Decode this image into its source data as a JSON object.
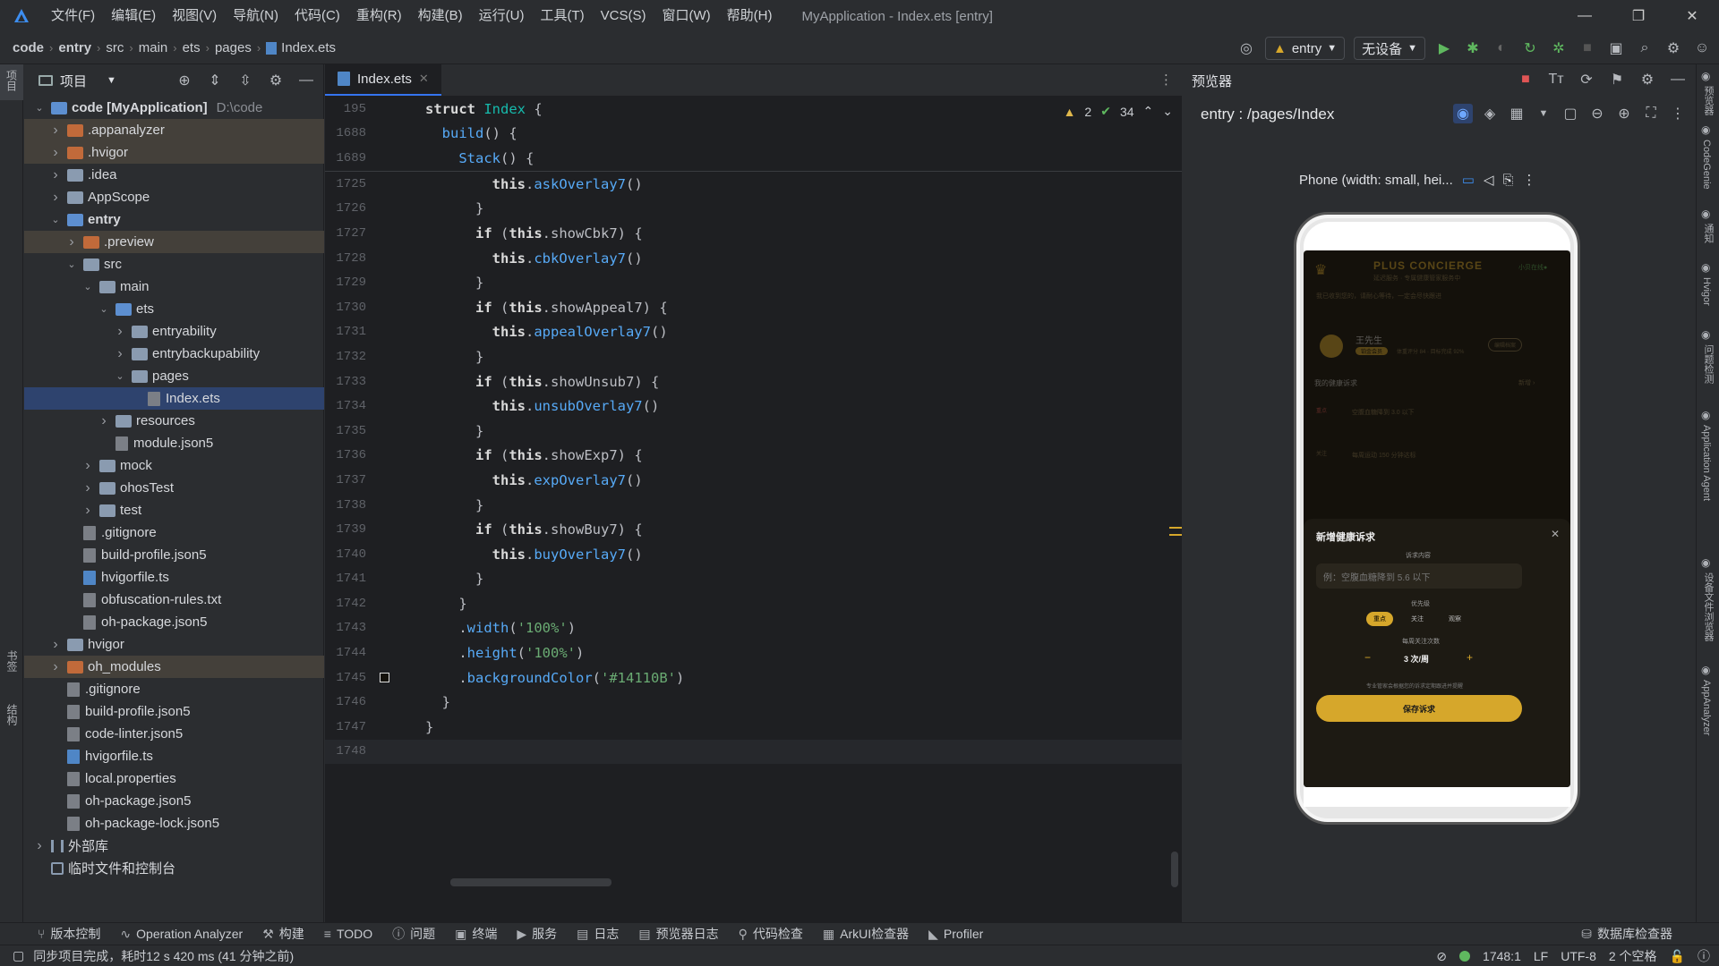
{
  "titlebar": {
    "menus": [
      "文件(F)",
      "编辑(E)",
      "视图(V)",
      "导航(N)",
      "代码(C)",
      "重构(R)",
      "构建(B)",
      "运行(U)",
      "工具(T)",
      "VCS(S)",
      "窗口(W)",
      "帮助(H)"
    ],
    "window_title": "MyApplication - Index.ets [entry]"
  },
  "navbar": {
    "breadcrumb": [
      "code",
      "entry",
      "src",
      "main",
      "ets",
      "pages",
      "Index.ets"
    ],
    "run_config": "entry",
    "device": "无设备"
  },
  "project": {
    "title": "项目",
    "tree": [
      {
        "label": "code [MyApplication]",
        "extra": "D:\\code",
        "level": 0,
        "arrow": "open",
        "icon": "folder-blue",
        "bold": true
      },
      {
        "label": ".appanalyzer",
        "level": 1,
        "arrow": "closed",
        "icon": "folder-orange",
        "hl": true
      },
      {
        "label": ".hvigor",
        "level": 1,
        "arrow": "closed",
        "icon": "folder-orange",
        "hl": true
      },
      {
        "label": ".idea",
        "level": 1,
        "arrow": "closed",
        "icon": "folder"
      },
      {
        "label": "AppScope",
        "level": 1,
        "arrow": "closed",
        "icon": "folder"
      },
      {
        "label": "entry",
        "level": 1,
        "arrow": "open",
        "icon": "folder-blue",
        "bold": true
      },
      {
        "label": ".preview",
        "level": 2,
        "arrow": "closed",
        "icon": "folder-orange",
        "hl": true
      },
      {
        "label": "src",
        "level": 2,
        "arrow": "open",
        "icon": "folder"
      },
      {
        "label": "main",
        "level": 3,
        "arrow": "open",
        "icon": "folder"
      },
      {
        "label": "ets",
        "level": 4,
        "arrow": "open",
        "icon": "folder-blue"
      },
      {
        "label": "entryability",
        "level": 5,
        "arrow": "closed",
        "icon": "folder"
      },
      {
        "label": "entrybackupability",
        "level": 5,
        "arrow": "closed",
        "icon": "folder"
      },
      {
        "label": "pages",
        "level": 5,
        "arrow": "open",
        "icon": "folder"
      },
      {
        "label": "Index.ets",
        "level": 6,
        "arrow": "none",
        "icon": "file",
        "sel": true
      },
      {
        "label": "resources",
        "level": 4,
        "arrow": "closed",
        "icon": "folder"
      },
      {
        "label": "module.json5",
        "level": 4,
        "arrow": "none",
        "icon": "file"
      },
      {
        "label": "mock",
        "level": 3,
        "arrow": "closed",
        "icon": "folder"
      },
      {
        "label": "ohosTest",
        "level": 3,
        "arrow": "closed",
        "icon": "folder"
      },
      {
        "label": "test",
        "level": 3,
        "arrow": "closed",
        "icon": "folder"
      },
      {
        "label": ".gitignore",
        "level": 2,
        "arrow": "none",
        "icon": "file"
      },
      {
        "label": "build-profile.json5",
        "level": 2,
        "arrow": "none",
        "icon": "file"
      },
      {
        "label": "hvigorfile.ts",
        "level": 2,
        "arrow": "none",
        "icon": "file-ts"
      },
      {
        "label": "obfuscation-rules.txt",
        "level": 2,
        "arrow": "none",
        "icon": "file"
      },
      {
        "label": "oh-package.json5",
        "level": 2,
        "arrow": "none",
        "icon": "file"
      },
      {
        "label": "hvigor",
        "level": 1,
        "arrow": "closed",
        "icon": "folder"
      },
      {
        "label": "oh_modules",
        "level": 1,
        "arrow": "closed",
        "icon": "folder-orange",
        "hl": true
      },
      {
        "label": ".gitignore",
        "level": 1,
        "arrow": "none",
        "icon": "file"
      },
      {
        "label": "build-profile.json5",
        "level": 1,
        "arrow": "none",
        "icon": "file"
      },
      {
        "label": "code-linter.json5",
        "level": 1,
        "arrow": "none",
        "icon": "file"
      },
      {
        "label": "hvigorfile.ts",
        "level": 1,
        "arrow": "none",
        "icon": "file-ts"
      },
      {
        "label": "local.properties",
        "level": 1,
        "arrow": "none",
        "icon": "file"
      },
      {
        "label": "oh-package.json5",
        "level": 1,
        "arrow": "none",
        "icon": "file"
      },
      {
        "label": "oh-package-lock.json5",
        "level": 1,
        "arrow": "none",
        "icon": "file"
      },
      {
        "label": "外部库",
        "level": 0,
        "arrow": "closed",
        "icon": "library"
      },
      {
        "label": "临时文件和控制台",
        "level": 0,
        "arrow": "none",
        "icon": "scratch"
      }
    ]
  },
  "editor": {
    "tab": "Index.ets",
    "warnings": "2",
    "checks": "34",
    "sticky": [
      {
        "ln": "195",
        "html": "<span class='kws'>struct</span> <span class='cls'>Index</span> {"
      },
      {
        "ln": "1688",
        "html": "  <span class='fn'>build</span>() {"
      },
      {
        "ln": "1689",
        "html": "    <span class='fn'>Stack</span>() {"
      }
    ],
    "lines": [
      {
        "ln": "1725",
        "html": "        <span class='kws'>this</span>.<span class='fn'>askOverlay7</span>()"
      },
      {
        "ln": "1726",
        "html": "      }"
      },
      {
        "ln": "1727",
        "html": "      <span class='kws'>if</span> (<span class='kws'>this</span>.showCbk7) {"
      },
      {
        "ln": "1728",
        "html": "        <span class='kws'>this</span>.<span class='fn'>cbkOverlay7</span>()"
      },
      {
        "ln": "1729",
        "html": "      }"
      },
      {
        "ln": "1730",
        "html": "      <span class='kws'>if</span> (<span class='kws'>this</span>.showAppeal7) {"
      },
      {
        "ln": "1731",
        "html": "        <span class='kws'>this</span>.<span class='fn'>appealOverlay7</span>()"
      },
      {
        "ln": "1732",
        "html": "      }"
      },
      {
        "ln": "1733",
        "html": "      <span class='kws'>if</span> (<span class='kws'>this</span>.showUnsub7) {"
      },
      {
        "ln": "1734",
        "html": "        <span class='kws'>this</span>.<span class='fn'>unsubOverlay7</span>()"
      },
      {
        "ln": "1735",
        "html": "      }"
      },
      {
        "ln": "1736",
        "html": "      <span class='kws'>if</span> (<span class='kws'>this</span>.showExp7) {"
      },
      {
        "ln": "1737",
        "html": "        <span class='kws'>this</span>.<span class='fn'>expOverlay7</span>()"
      },
      {
        "ln": "1738",
        "html": "      }"
      },
      {
        "ln": "1739",
        "html": "      <span class='kws'>if</span> (<span class='kws'>this</span>.showBuy7) {"
      },
      {
        "ln": "1740",
        "html": "        <span class='kws'>this</span>.<span class='fn'>buyOverlay7</span>()"
      },
      {
        "ln": "1741",
        "html": "      }"
      },
      {
        "ln": "1742",
        "html": "    }"
      },
      {
        "ln": "1743",
        "html": "    .<span class='fn'>width</span>(<span class='str'>'100%'</span>)"
      },
      {
        "ln": "1744",
        "html": "    .<span class='fn'>height</span>(<span class='str'>'100%'</span>)"
      },
      {
        "ln": "1745",
        "html": "    .<span class='fn'>backgroundColor</span>(<span class='str'>'#14110B'</span>)"
      },
      {
        "ln": "1746",
        "html": "  }"
      },
      {
        "ln": "1747",
        "html": "}"
      },
      {
        "ln": "1748",
        "html": ""
      }
    ]
  },
  "preview": {
    "title": "预览器",
    "route": "entry : /pages/Index",
    "device_label": "Phone (width: small, hei...",
    "app": {
      "brand": "PLUS CONCIERGE",
      "brand_sub": "延迟服务 · 专属健康管家服务中",
      "badge": "小贝在线●",
      "notice": "我已收到您的，请耐心等待，一定会尽快跟进",
      "user_name": "王先生",
      "user_tag": "铂金会员",
      "user_meta": "体重评分 84 · 目标完成 92%",
      "user_btn": "编辑档案",
      "section": "我的健康诉求",
      "section_more": "新增 ›",
      "item1": "空腹血糖降到 3.0 以下",
      "item1_tag": "重点",
      "item2": "每周运动 150 分钟达标",
      "item2_tag": "关注",
      "sheet_title": "新增健康诉求",
      "field_label": "诉求内容",
      "field_placeholder": "例：空腹血糖降到 5.6 以下",
      "priority_label": "优先级",
      "priority_opts": [
        "重点",
        "关注",
        "观察"
      ],
      "count_label": "每周关注次数",
      "count_value": "3 次/周",
      "hint": "专业管家会根据您的诉求定期跟进并提醒",
      "save_btn": "保存诉求"
    }
  },
  "toolwindows": [
    "版本控制",
    "Operation Analyzer",
    "构建",
    "TODO",
    "问题",
    "终端",
    "服务",
    "日志",
    "预览器日志",
    "代码检查",
    "ArkUI检查器",
    "Profiler"
  ],
  "toolwindows_right": "数据库检查器",
  "statusbar": {
    "message": "同步项目完成，耗时12 s 420 ms (41 分钟之前)",
    "position": "1748:1",
    "line_sep": "LF",
    "encoding": "UTF-8",
    "indent": "2 个空格"
  },
  "left_strip": {
    "top": "项目",
    "bottom1": "书签",
    "bottom2": "结构"
  },
  "right_strip": [
    "预览器",
    "CodeGenie",
    "通知",
    "Hvigor",
    "问题检测",
    "Application Agent",
    "设备文件浏览器",
    "AppAnalyzer"
  ],
  "colors": {
    "accent": "#3574f0",
    "gold": "#d6a72b",
    "app_bg": "#14110B"
  }
}
